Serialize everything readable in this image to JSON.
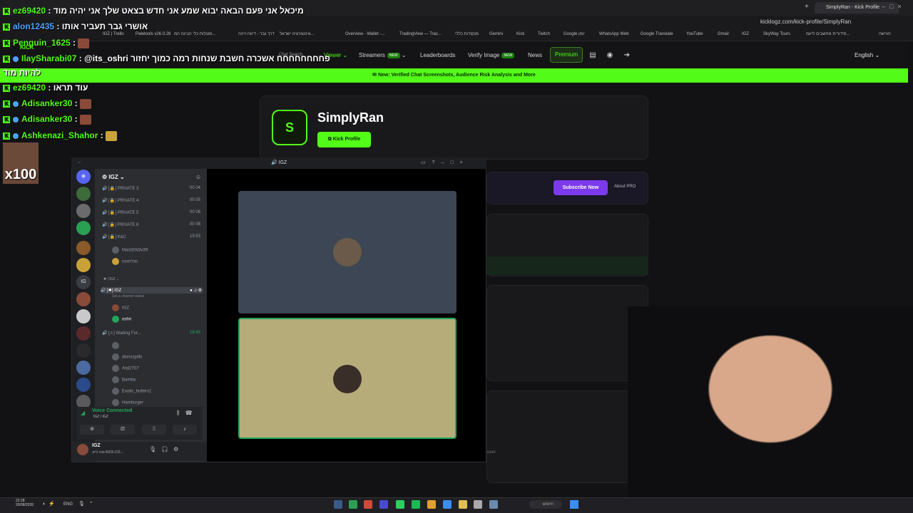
{
  "browser": {
    "tab_title": "SimplyRan - Kick Profile",
    "url": "kicklogz.com/kick-profile/SimplyRan",
    "bookmarks": [
      "IGZ | Trello",
      "Paletools v26.0.28",
      "סגנלות כלי הבינה המ...",
      "דרך גבר - דיווח זיינה",
      "אינטגרציה ישראל...",
      "Overview - Wallet -...",
      "TradingView — Trac...",
      "מנקודות כללי",
      "Gemini",
      "Kick",
      "Twitch",
      "Google יומן",
      "WhatsApp Web",
      "Google Translate",
      "YouTube",
      "Gmail",
      "IGZ",
      "SkyWay Tours",
      "סידורית מחשבים ליעמ...",
      "הורשה"
    ]
  },
  "site": {
    "chat_search": "Chat Search",
    "nav": {
      "viewer": "Viewer",
      "streamers": "Streamers",
      "streamers_badge": "NEW",
      "leaderboards": "Leaderboards",
      "verify_image": "Verify Image",
      "verify_badge": "NEW",
      "news": "News",
      "premium": "Premium",
      "language": "English"
    },
    "banner": "New: Verified Chat Screenshots, Audience Risk Analysis and More",
    "profile": {
      "initial": "S",
      "name": "SimplyRan",
      "kick_button": "Kick Profile",
      "subscribe_button": "Subscribe Now",
      "about_pro": "About PRO",
      "trailing_text": "user."
    }
  },
  "chat": [
    {
      "user": "ez69420",
      "color": "#53fc18",
      "text": ": מיכאל אני פעם הבאה יבוא שמע אני חדש בצאט שלך אני יהיה מוד"
    },
    {
      "user": "alon12435",
      "color": "#4aa3ff",
      "text": ": אושרי גבר תעביר אותו"
    },
    {
      "user": "Penguin_1625",
      "color": "#53fc18",
      "text": ":"
    },
    {
      "user": "IlaySharabi07",
      "color": "#53fc18",
      "text": ": @its_oshri פחחחחחחחח אשכרה חשבת שנחות רמה כמוך יחזור"
    },
    {
      "user": "",
      "color": "#53fc18",
      "text": "להיות מוד"
    },
    {
      "user": "ez69420",
      "color": "#53fc18",
      "text": ": עוד תראו"
    },
    {
      "user": "Adisanker30",
      "color": "#53fc18",
      "text": ":"
    },
    {
      "user": "Adisanker30",
      "color": "#53fc18",
      "text": ":"
    },
    {
      "user": "Ashkenazi_Shahor",
      "color": "#53fc18",
      "text": ":"
    }
  ],
  "chat_overlay": {
    "x100": "x100",
    "kick": "KICK"
  },
  "discord": {
    "window_title": "IGZ",
    "server_name": "IGZ",
    "channels": [
      {
        "name": "PRIVATE 3",
        "count": "00 04"
      },
      {
        "name": "PRIVATE 4",
        "count": "00 05"
      },
      {
        "name": "PRIVATE 5",
        "count": "00 06"
      },
      {
        "name": "PRIVATE 6",
        "count": "00 08"
      },
      {
        "name": "K&C",
        "count": "15:53"
      }
    ],
    "kc_members": [
      "Mast3rN3v3R",
      "סוליסונס"
    ],
    "category": "IGZ",
    "active_channel": "IGZ",
    "channel_status": "Set a channel status",
    "igz_members": [
      "IGZ",
      "oshri"
    ],
    "waiting_channel": "Waiting For...",
    "waiting_count": "18:45",
    "waiting_members": [
      "",
      "alonszydlo",
      "Atal2707",
      "Bamba",
      "Exotic_butters1",
      "Hamburger"
    ],
    "voice_status": "Voice Connected",
    "voice_sub": "IGZ / IGZ",
    "user_name": "IGZ",
    "user_status": "גנרו לייב KICK.CO..."
  },
  "taskbar": {
    "time": "22:28",
    "date": "20/08/2026",
    "lang": "ENG",
    "search": "חיפוש"
  }
}
